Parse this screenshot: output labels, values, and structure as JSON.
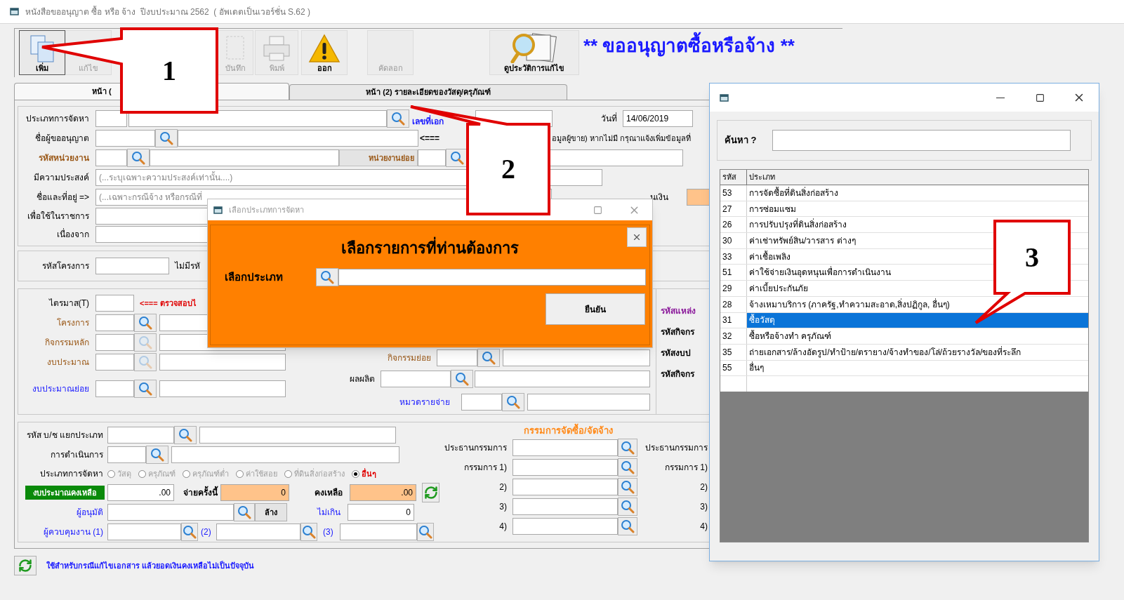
{
  "window": {
    "title": "หนังสือขออนุญาต ซื้อ หรือ จ้าง  ปีงบประมาณ 2562  ( อัพเดตเป็นเวอร์ชั่น S.62 )"
  },
  "toolbar": [
    {
      "label": "เพิ่ม",
      "kind": "add",
      "disabled": false
    },
    {
      "label": "แก้ไข",
      "kind": "edit",
      "disabled": true
    },
    {
      "label": "บันทึก",
      "kind": "save",
      "disabled": true
    },
    {
      "label": "พิมพ์",
      "kind": "print",
      "disabled": true
    },
    {
      "label": "ออก",
      "kind": "exit",
      "disabled": false
    },
    {
      "label": "คัดลอก",
      "kind": "copy",
      "disabled": true
    },
    {
      "label": "ดูประวัติการแก้ไข",
      "kind": "history",
      "disabled": false
    }
  ],
  "heading": "** ขออนุญาตซื้อหรือจ้าง **",
  "tabs": [
    {
      "label": "หน้า (",
      "selected": true
    },
    {
      "label": "หน้า (2) รายละเอียดของวัสดุ/ครุภัณฑ์",
      "selected": false
    }
  ],
  "general": {
    "procurement_type_label": "ประเภทการจัดหา",
    "doc_no_label": "เลขที่เอก",
    "date_label": "วันที่",
    "date_value": "14/06/2019",
    "requester_label": "ชื่อผู้ขออนุญาต",
    "arrow_note": "<===",
    "vendor_note": "อมูลผู้ขาย) หากไม่มี กรุณาแจ้งเพิ่มข้อมูลที่",
    "unit_label": "รหัสหน่วยงาน",
    "subunit_label": "หน่วยงานย่อย",
    "purpose_label": "มีความประสงค์",
    "purpose_placeholder": "(...ระบุเฉพาะความประสงค์เท่านั้น....)",
    "address_label": "ชื่อและที่อยู่ =>",
    "address_placeholder": "(...เฉพาะกรณีจ้าง หรือกรณีที่",
    "amount_label": "นเงิน",
    "for_label": "เพื่อใช้ในราชการ",
    "reason_label": "เนื่องจาก"
  },
  "project": {
    "code_label": "รหัสโครงการ",
    "no_code_label": "ไม่มีรหั"
  },
  "budget": {
    "quarter_label": "ไตรมาส(T)",
    "check_note": "<=== ตรวจสอบไ",
    "project_label": "โครงการ",
    "main_activity_label": "กิจกรรมหลัก",
    "budget_label": "งบประมาณ",
    "sub_budget_label": "งบประมาณย่อย",
    "sub_activity_label": "กิจกรรมย่อย",
    "output_label": "ผลผลิต",
    "expense_label": "หมวดรายจ่าย",
    "source_labels": [
      "รหัสแหล่ง",
      "รหัสกิจกร",
      "รหัสงบป",
      "รหัสกิจกร"
    ]
  },
  "accounting": {
    "ledger_label": "รหัส บ/ช แยกประเภท",
    "operation_label": "การดำเนินการ",
    "type_label": "ประเภทการจัดหา",
    "types": [
      {
        "label": "วัสดุ",
        "selected": false
      },
      {
        "label": "ครุภัณฑ์",
        "selected": false
      },
      {
        "label": "ครุภัณฑ์ต่ำ",
        "selected": false
      },
      {
        "label": "ค่าใช้สอย",
        "selected": false
      },
      {
        "label": "ที่ดินสิ่งก่อสร้าง",
        "selected": false
      },
      {
        "label": "อื่นๆ",
        "selected": true
      }
    ],
    "remaining_budget_label": "งบประมาณคงเหลือ",
    "remaining_budget_value": ".00",
    "pay_label": "จ่ายครั้งนี้",
    "pay_value": "0",
    "balance_label": "คงเหลือ",
    "balance_value": ".00",
    "approver_label": "ผู้อนุมัติ",
    "clear_button": "ล้าง",
    "limit_label": "ไม่เกิน",
    "limit_value": "0",
    "supervisor_labels": [
      "ผู้ควบคุมงาน (1)",
      "(2)",
      "(3)"
    ]
  },
  "committee": {
    "title": "กรรมการจัดซื้อ/จัดจ้าง",
    "rows": [
      "ประธานกรรมการ",
      "กรรมการ 1)",
      "2)",
      "3)",
      "4)"
    ],
    "rows_right": [
      "ประธานกรรมการ",
      "กรรมการ 1)",
      "2)",
      "3)",
      "4)"
    ]
  },
  "footer_note": "ใช้สำหรับกรณีแก้ไขเอกสาร แล้วยอดเงินคงเหลือไม่เป็นปัจจุบัน",
  "type_dialog": {
    "title": "เลือกประเภทการจัดหา",
    "heading": "เลือกรายการที่ท่านต้องการ",
    "field_label": "เลือกประเภท",
    "confirm": "ยืนยัน"
  },
  "list_dialog": {
    "search_label": "ค้นหา ?",
    "columns": [
      "รหัส",
      "ประเภท"
    ],
    "rows": [
      {
        "code": "53",
        "name": "การจัดซื้อที่ดินสิ่งก่อสร้าง",
        "selected": false
      },
      {
        "code": "27",
        "name": "การซ่อมแซม",
        "selected": false
      },
      {
        "code": "26",
        "name": "การปรับปรุงที่ดินสิ่งก่อสร้าง",
        "selected": false
      },
      {
        "code": "30",
        "name": "ค่าเช่าทรัพย์สิน/วารสาร ต่างๆ",
        "selected": false
      },
      {
        "code": "33",
        "name": "ค่าเชื้อเพลิง",
        "selected": false
      },
      {
        "code": "51",
        "name": "ค่าใช้จ่ายเงินอุดหนุนเพื่อการดำเนินงาน",
        "selected": false
      },
      {
        "code": "29",
        "name": "ค่าเบี้ยประกันภัย",
        "selected": false
      },
      {
        "code": "28",
        "name": "จ้างเหมาบริการ (ภาครัฐ,ทำความสะอาด,สิ่งปฏิกูล, อื่นๆ)",
        "selected": false
      },
      {
        "code": "31",
        "name": "ซื้อวัสดุ",
        "selected": true
      },
      {
        "code": "32",
        "name": "ซื้อหรือจ้างทำ ครุภัณฑ์",
        "selected": false
      },
      {
        "code": "35",
        "name": "ถ่ายเอกสาร/ล้างอัดรูป/ทำป้าย/ตรายาง/จ้างทำของ/โล่/ถ้วยรางวัล/ของที่ระลึก",
        "selected": false
      },
      {
        "code": "55",
        "name": "อื่นๆ",
        "selected": false
      }
    ]
  },
  "callouts": [
    {
      "label": "1"
    },
    {
      "label": "2"
    },
    {
      "label": "3"
    }
  ]
}
